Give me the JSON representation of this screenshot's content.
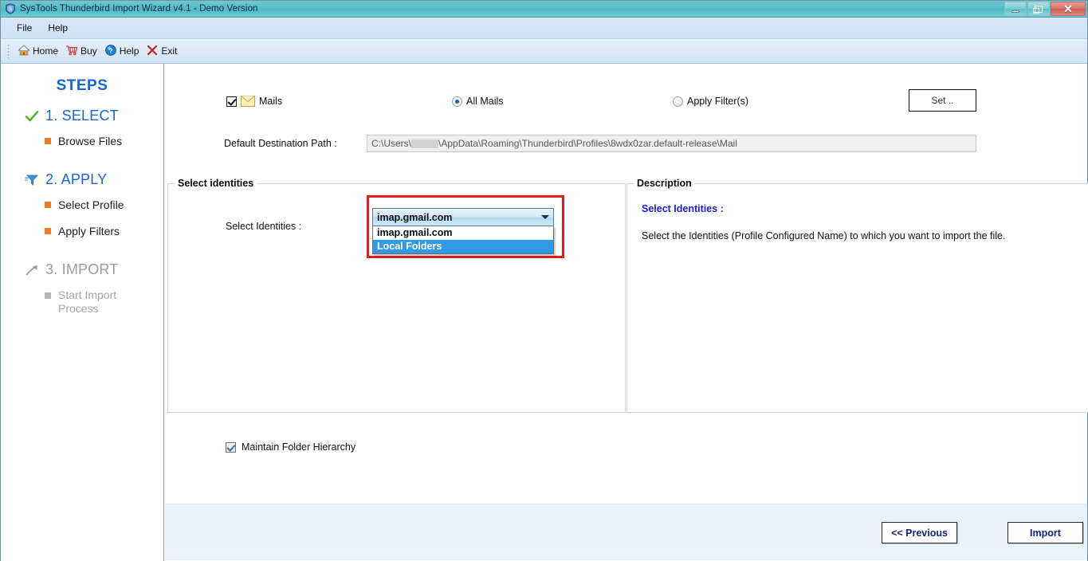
{
  "window": {
    "title": "SysTools Thunderbird Import Wizard v4.1 - Demo Version",
    "app_icon": "shield-icon",
    "controls": {
      "minimize": "minimize-icon",
      "maximize": "maximize-icon",
      "close": "✕"
    }
  },
  "menubar": {
    "items": [
      {
        "label": "File"
      },
      {
        "label": "Help"
      }
    ]
  },
  "toolbar": {
    "items": [
      {
        "label": "Home",
        "icon": "home-icon"
      },
      {
        "label": "Buy",
        "icon": "cart-icon"
      },
      {
        "label": "Help",
        "icon": "help-circle-icon"
      },
      {
        "label": "Exit",
        "icon": "close-x-icon"
      }
    ]
  },
  "sidebar": {
    "title": "STEPS",
    "steps": [
      {
        "number_label": "1. SELECT",
        "icon": "green-check-icon",
        "state": "done",
        "substeps": [
          {
            "label": "Browse Files",
            "state": "active"
          }
        ]
      },
      {
        "number_label": "2. APPLY",
        "icon": "filter-icon",
        "state": "current",
        "substeps": [
          {
            "label": "Select Profile",
            "state": "active"
          },
          {
            "label": "Apply Filters",
            "state": "active"
          }
        ]
      },
      {
        "number_label": "3. IMPORT",
        "icon": "arrow-up-right-icon",
        "state": "disabled",
        "substeps": [
          {
            "label": "Start Import Process",
            "state": "disabled"
          }
        ]
      }
    ]
  },
  "main": {
    "options": {
      "mails_checkbox": {
        "label": "Mails",
        "checked": true,
        "icon": "envelope-icon"
      },
      "all_mails_radio": {
        "label": "All Mails",
        "selected": true
      },
      "apply_filters_radio": {
        "label": "Apply Filter(s)",
        "selected": false
      },
      "set_button": "Set .."
    },
    "destination": {
      "label": "Default Destination Path :",
      "value_prefix": "C:\\Users\\",
      "value_suffix": "\\AppData\\Roaming\\Thunderbird\\Profiles\\8wdx0zar.default-release\\Mail",
      "redacted": true
    },
    "identities_group": {
      "legend": "Select identities",
      "field_label": "Select Identities :",
      "combo": {
        "selected": "imap.gmail.com",
        "expanded": true,
        "options": [
          {
            "label": "imap.gmail.com",
            "highlighted": false
          },
          {
            "label": "Local Folders",
            "highlighted": true
          }
        ]
      },
      "highlight_box_color": "#e21b1b"
    },
    "description_group": {
      "legend": "Description",
      "title": "Select Identities :",
      "body": "Select the Identities (Profile Configured Name) to  which  you want to import the file.",
      "title_color": "#1a1ae0"
    },
    "maintain_hierarchy": {
      "label": "Maintain Folder Hierarchy",
      "checked": true
    }
  },
  "footer": {
    "previous_button": "<< Previous",
    "import_button": "Import"
  },
  "colors": {
    "title_bar": "#58bfc7",
    "accent_blue": "#1565d8",
    "bullet_orange": "#ef7b23",
    "button_text": "#11257a",
    "highlight_red": "#e21b1b",
    "list_selection": "#2f9ae8"
  }
}
